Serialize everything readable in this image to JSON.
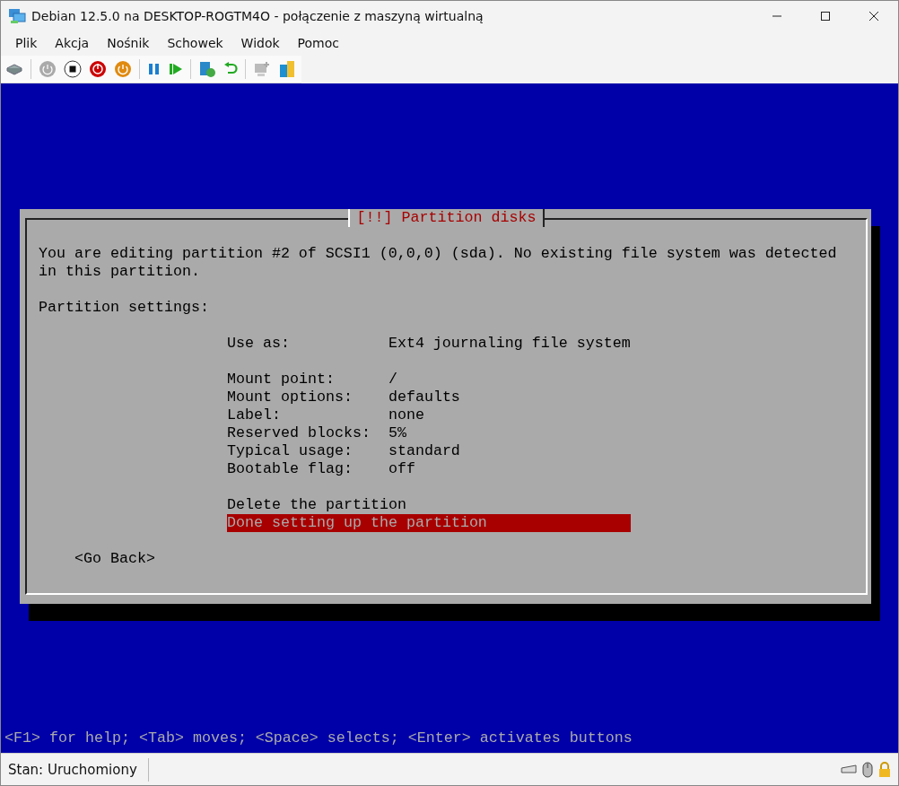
{
  "window": {
    "title": "Debian 12.5.0 na DESKTOP-ROGTM4O - połączenie z maszyną wirtualną"
  },
  "menu": [
    "Plik",
    "Akcja",
    "Nośnik",
    "Schowek",
    "Widok",
    "Pomoc"
  ],
  "dialog": {
    "title": "[!!] Partition disks",
    "message": "You are editing partition #2 of SCSI1 (0,0,0) (sda). No existing file system was detected in this partition.",
    "section_label": "Partition settings:",
    "usage": [
      {
        "label": "Use as:",
        "value": "Ext4 journaling file system"
      }
    ],
    "options": [
      {
        "label": "Mount point:",
        "value": "/"
      },
      {
        "label": "Mount options:",
        "value": "defaults"
      },
      {
        "label": "Label:",
        "value": "none"
      },
      {
        "label": "Reserved blocks:",
        "value": "5%"
      },
      {
        "label": "Typical usage:",
        "value": "standard"
      },
      {
        "label": "Bootable flag:",
        "value": "off"
      }
    ],
    "actions": [
      {
        "label": "Delete the partition",
        "selected": false
      },
      {
        "label": "Done setting up the partition",
        "selected": true
      }
    ],
    "back_button": "<Go Back>"
  },
  "help_line": "<F1> for help; <Tab> moves; <Space> selects; <Enter> activates buttons",
  "status_bar": {
    "status": "Stan: Uruchomiony"
  }
}
